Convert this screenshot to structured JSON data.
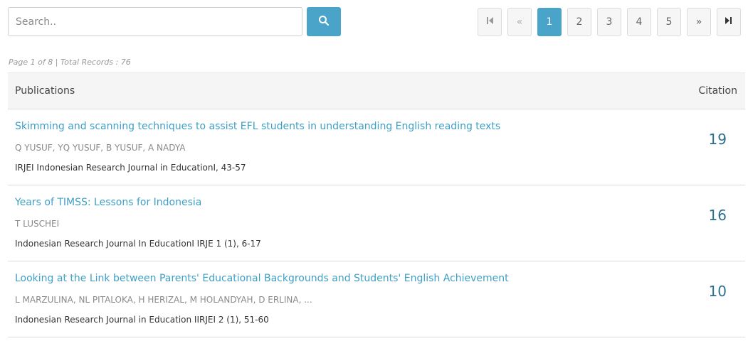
{
  "search": {
    "placeholder": "Search.."
  },
  "pagination": {
    "first": "⏮",
    "prev": "«",
    "pages": [
      "1",
      "2",
      "3",
      "4",
      "5"
    ],
    "active_page": "1",
    "next": "»",
    "last": "⏭"
  },
  "page_info": "Page 1 of 8 | Total Records : 76",
  "table": {
    "header_publications": "Publications",
    "header_citation": "Citation",
    "rows": [
      {
        "title": "Skimming and scanning techniques to assist EFL students in understanding English reading texts",
        "authors": "Q YUSUF, YQ YUSUF, B YUSUF, A NADYA",
        "venue": "IRJEI Indonesian Research Journal in EducationI, 43-57",
        "citation": "19"
      },
      {
        "title": "Years of TIMSS: Lessons for Indonesia",
        "authors": "T LUSCHEI",
        "venue": "Indonesian Research Journal In EducationI IRJE 1 (1), 6-17",
        "citation": "16"
      },
      {
        "title": "Looking at the Link between Parents' Educational Backgrounds and Students' English Achievement",
        "authors": "L MARZULINA, NL PITALOKA, H HERIZAL, M HOLANDYAH, D ERLINA, ...",
        "venue": "Indonesian Research Journal in Education IIRJEI 2 (1), 51-60",
        "citation": "10"
      }
    ]
  },
  "colors": {
    "accent": "#4aa3c8",
    "link": "#3f9fc5",
    "citation": "#2c6e8f"
  }
}
